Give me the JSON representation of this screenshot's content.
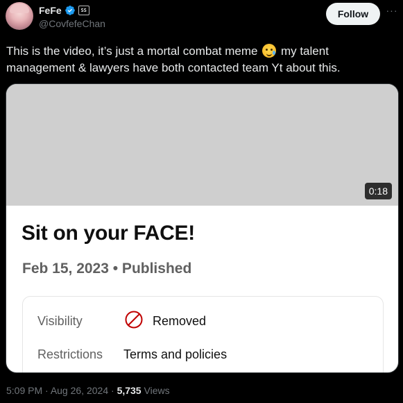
{
  "author": {
    "display_name": "FeFe",
    "handle": "@CovfefeChan",
    "verified_color": "#1d9bf0",
    "affiliate_badge_text": "SS",
    "icons": [
      "verified-icon",
      "affiliate-badge-icon"
    ]
  },
  "actions": {
    "follow_label": "Follow",
    "more_label": "···"
  },
  "tweet": {
    "text_before_emoji": "This is the video, it’s just a mortal combat meme ",
    "emoji_name": "face-holding-back-tears",
    "text_after_emoji": " my talent management & lawyers have both contacted team Yt about this."
  },
  "media": {
    "duration": "0:18",
    "video_title": "Sit on your FACE!",
    "meta": "Feb 15, 2023 • Published",
    "details": [
      {
        "label": "Visibility",
        "value": "Removed",
        "icon": "prohibited-icon",
        "icon_color": "#c00000"
      },
      {
        "label": "Restrictions",
        "value": "Terms and policies"
      }
    ]
  },
  "footer": {
    "time": "5:09 PM",
    "separator": " · ",
    "date": "Aug 26, 2024",
    "views_count": "5,735",
    "views_label": " Views"
  }
}
